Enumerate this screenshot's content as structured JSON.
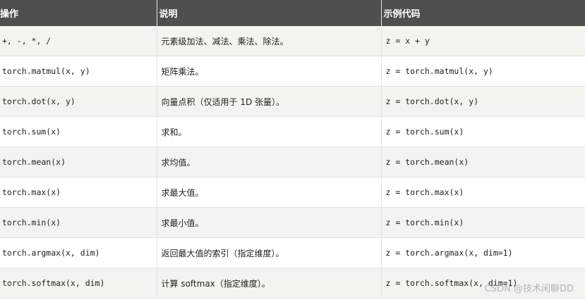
{
  "table": {
    "headers": [
      "操作",
      "说明",
      "示例代码"
    ],
    "rows": [
      {
        "op": "+, -, *, /",
        "desc": "元素级加法、减法、乘法、除法。",
        "example": "z = x + y"
      },
      {
        "op": "torch.matmul(x, y)",
        "desc": "矩阵乘法。",
        "example": "z = torch.matmul(x, y)"
      },
      {
        "op": "torch.dot(x, y)",
        "desc": "向量点积（仅适用于 1D 张量）。",
        "example": "z = torch.dot(x, y)"
      },
      {
        "op": "torch.sum(x)",
        "desc": "求和。",
        "example": "z = torch.sum(x)"
      },
      {
        "op": "torch.mean(x)",
        "desc": "求均值。",
        "example": "z = torch.mean(x)"
      },
      {
        "op": "torch.max(x)",
        "desc": "求最大值。",
        "example": "z = torch.max(x)"
      },
      {
        "op": "torch.min(x)",
        "desc": "求最小值。",
        "example": "z = torch.min(x)"
      },
      {
        "op": "torch.argmax(x, dim)",
        "desc": "返回最大值的索引（指定维度）。",
        "example": "z = torch.argmax(x, dim=1)"
      },
      {
        "op": "torch.softmax(x, dim)",
        "desc": "计算 softmax（指定维度）。",
        "example": "z = torch.softmax(x, dim=1)"
      }
    ]
  },
  "watermark": "CSDN @技术闲聊DD"
}
